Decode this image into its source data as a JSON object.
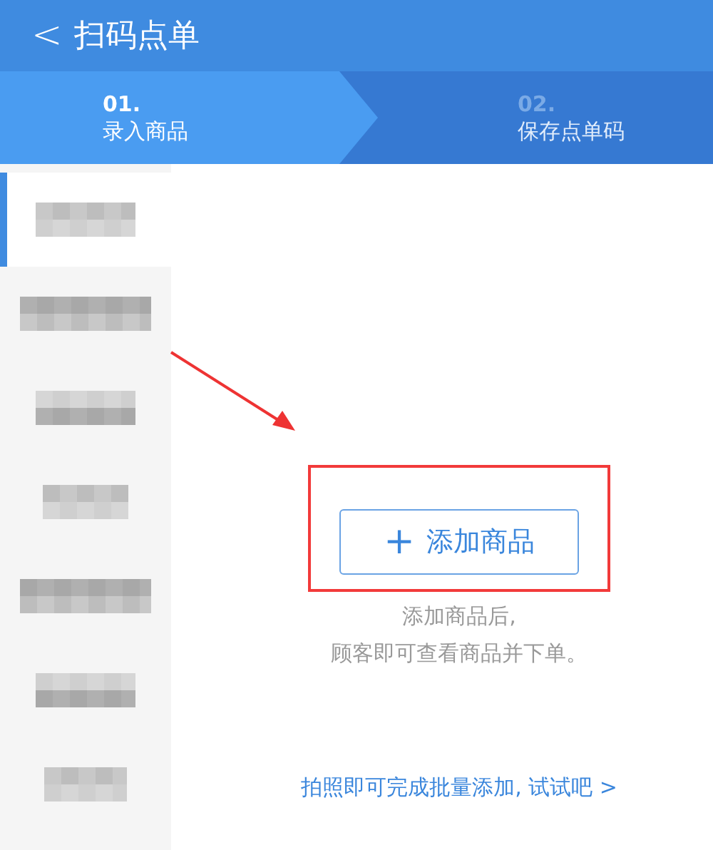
{
  "header": {
    "back_icon": "<",
    "title": "扫码点单"
  },
  "steps": [
    {
      "number": "01.",
      "label": "录入商品",
      "selected": true
    },
    {
      "number": "02.",
      "label": "保存点单码",
      "selected": false
    }
  ],
  "sidebar": {
    "items": [
      {
        "selected": true
      },
      {
        "selected": false
      },
      {
        "selected": false
      },
      {
        "selected": false
      },
      {
        "selected": false
      },
      {
        "selected": false
      },
      {
        "selected": false
      }
    ]
  },
  "main": {
    "add_button": {
      "icon": "+",
      "label": "添加商品"
    },
    "hint_lines": [
      "添加商品后,",
      "顾客即可查看商品并下单。"
    ],
    "link": "拍照即可完成批量添加, 试试吧 >"
  },
  "annotation_arrow": true,
  "annotation_box": true
}
